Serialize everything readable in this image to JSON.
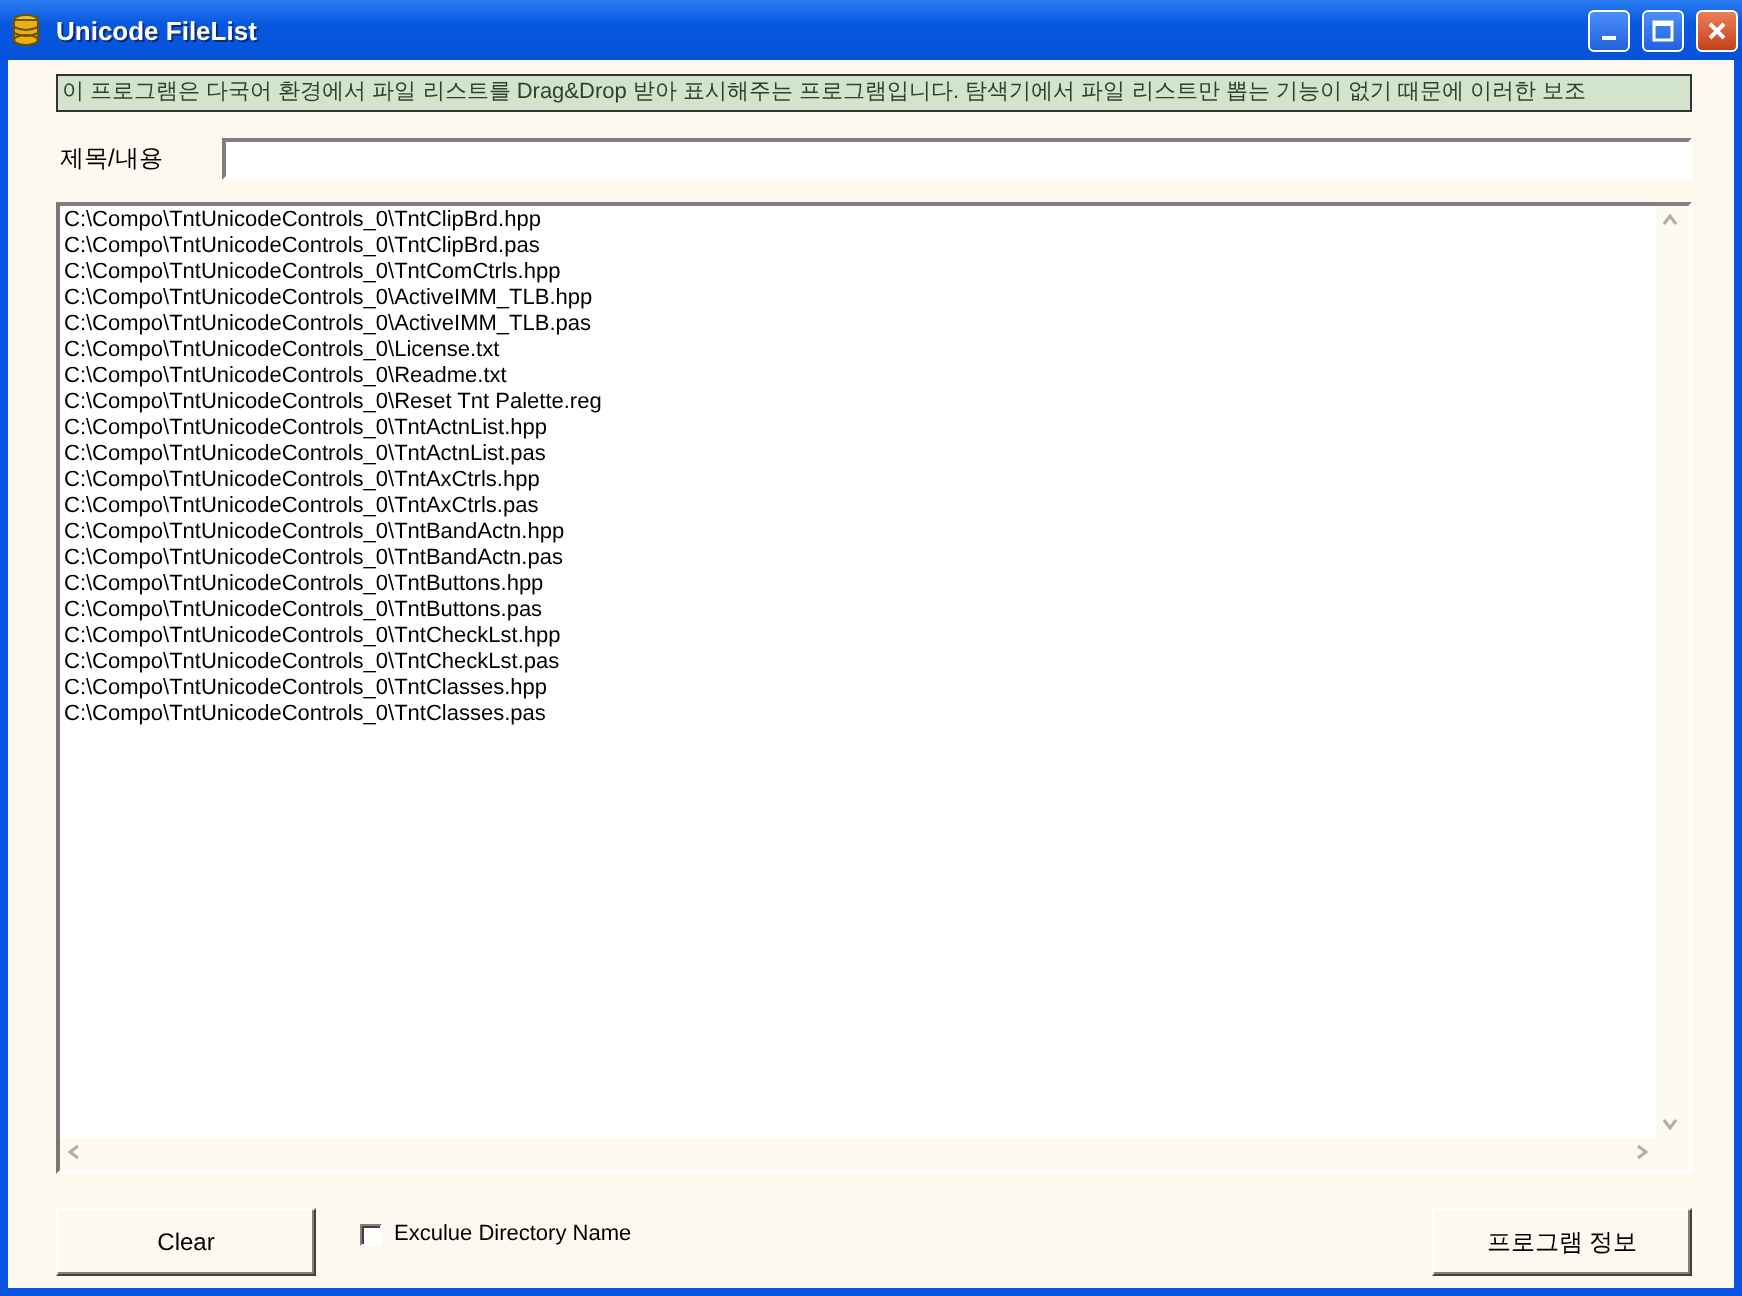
{
  "window": {
    "title": "Unicode FileList"
  },
  "banner": "이 프로그램은 다국어 환경에서 파일 리스트를 Drag&Drop 받아 표시해주는 프로그램입니다. 탐색기에서 파일 리스트만 뽑는 기능이 없기 때문에 이러한 보조",
  "title_field": {
    "label": "제목/내용"
  },
  "files": [
    "C:\\Compo\\TntUnicodeControls_0\\TntClipBrd.hpp",
    "C:\\Compo\\TntUnicodeControls_0\\TntClipBrd.pas",
    "C:\\Compo\\TntUnicodeControls_0\\TntComCtrls.hpp",
    "C:\\Compo\\TntUnicodeControls_0\\ActiveIMM_TLB.hpp",
    "C:\\Compo\\TntUnicodeControls_0\\ActiveIMM_TLB.pas",
    "C:\\Compo\\TntUnicodeControls_0\\License.txt",
    "C:\\Compo\\TntUnicodeControls_0\\Readme.txt",
    "C:\\Compo\\TntUnicodeControls_0\\Reset Tnt Palette.reg",
    "C:\\Compo\\TntUnicodeControls_0\\TntActnList.hpp",
    "C:\\Compo\\TntUnicodeControls_0\\TntActnList.pas",
    "C:\\Compo\\TntUnicodeControls_0\\TntAxCtrls.hpp",
    "C:\\Compo\\TntUnicodeControls_0\\TntAxCtrls.pas",
    "C:\\Compo\\TntUnicodeControls_0\\TntBandActn.hpp",
    "C:\\Compo\\TntUnicodeControls_0\\TntBandActn.pas",
    "C:\\Compo\\TntUnicodeControls_0\\TntButtons.hpp",
    "C:\\Compo\\TntUnicodeControls_0\\TntButtons.pas",
    "C:\\Compo\\TntUnicodeControls_0\\TntCheckLst.hpp",
    "C:\\Compo\\TntUnicodeControls_0\\TntCheckLst.pas",
    "C:\\Compo\\TntUnicodeControls_0\\TntClasses.hpp",
    "C:\\Compo\\TntUnicodeControls_0\\TntClasses.pas"
  ],
  "clear_button": "Clear",
  "exclude_directory": {
    "label": "Exculue Directory Name",
    "checked": false
  },
  "info_button": "프로그램 정보"
}
